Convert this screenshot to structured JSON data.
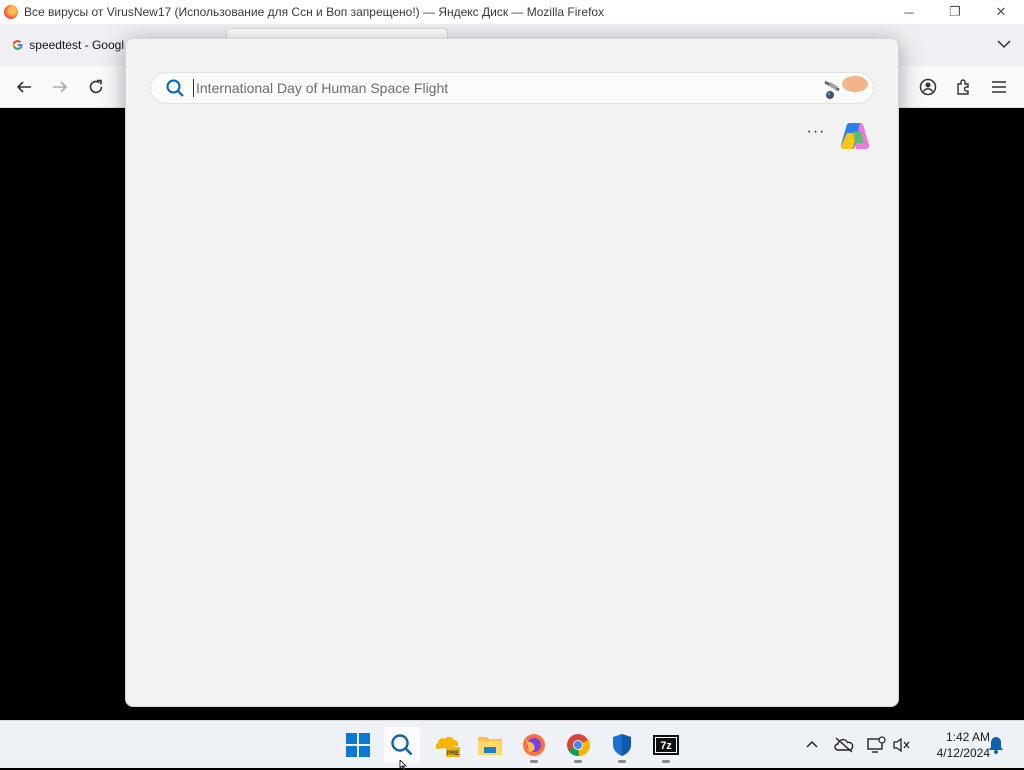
{
  "window": {
    "title": "Все вирусы от VirusNew17 (Использование для Ссн и Воп запрещено!) — Яндекс Диск — Mozilla Firefox",
    "controls": {
      "minimize": "─",
      "restore": "❐",
      "close": "✕"
    }
  },
  "tabs": [
    {
      "label": "speedtest - Googl",
      "icon": "google-icon"
    }
  ],
  "search": {
    "placeholder": "International Day of Human Space Flight",
    "value": ""
  },
  "flyout": {
    "more_label": "···"
  },
  "taskbar": {
    "apps": [
      "start-icon",
      "search-icon",
      "onedrive-pre-icon",
      "file-explorer-icon",
      "firefox-icon",
      "chrome-icon",
      "defender-icon",
      "7zip-icon"
    ],
    "sevenzip_label": "7z",
    "pre_label": "PRE"
  },
  "clock": {
    "time": "1:42 AM",
    "date": "4/12/2024"
  },
  "colors": {
    "accent": "#0067c0",
    "taskbar_bg": "#eef1f6",
    "flyout_bg": "#f2f2f2"
  }
}
